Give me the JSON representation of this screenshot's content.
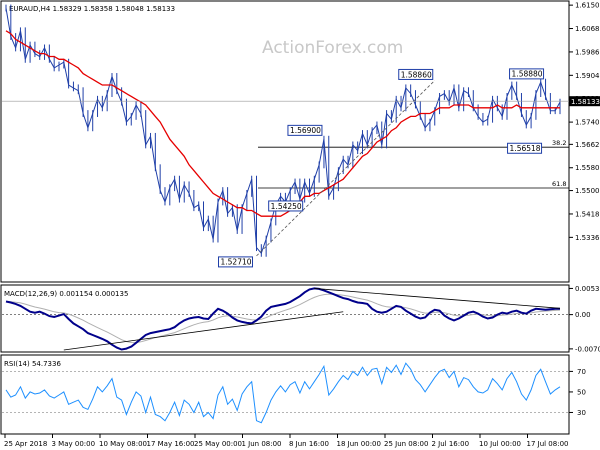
{
  "watermark": "ActionForex.com",
  "chart_data": [
    {
      "type": "line",
      "title": "EURAUD,H4  1.58329 1.58358 1.58048 1.58133",
      "series": [
        {
          "values": [
            1.614,
            1.604,
            1.6,
            1.606,
            1.596,
            1.601,
            1.598,
            1.597,
            1.6,
            1.596,
            1.593,
            1.594,
            1.595,
            1.587,
            1.586,
            1.585,
            1.577,
            1.572,
            1.577,
            1.582,
            1.579,
            1.584,
            1.59,
            1.585,
            1.581,
            1.574,
            1.576,
            1.58,
            1.577,
            1.566,
            1.569,
            1.558,
            1.55,
            1.546,
            1.551,
            1.554,
            1.547,
            1.552,
            1.549,
            1.544,
            1.545,
            1.537,
            1.54,
            1.533,
            1.546,
            1.55,
            1.542,
            1.544,
            1.536,
            1.544,
            1.549,
            1.554,
            1.53,
            1.528,
            1.533,
            1.539,
            1.545,
            1.548,
            1.546,
            1.55,
            1.553,
            1.547,
            1.553,
            1.549,
            1.554,
            1.559,
            1.568,
            1.548,
            1.551,
            1.557,
            1.561,
            1.559,
            1.566,
            1.564,
            1.57,
            1.566,
            1.571,
            1.573,
            1.566,
            1.577,
            1.575,
            1.582,
            1.579,
            1.586,
            1.584,
            1.58,
            1.576,
            1.572,
            1.574,
            1.578,
            1.583,
            1.584,
            1.581,
            1.586,
            1.579,
            1.585,
            1.584,
            1.579,
            1.576,
            1.574,
            1.575,
            1.582,
            1.579,
            1.576,
            1.583,
            1.587,
            1.583,
            1.577,
            1.573,
            1.576,
            1.584,
            1.588,
            1.583,
            1.578,
            1.578,
            1.581
          ]
        },
        {
          "values": [
            1.606,
            1.605,
            1.603,
            1.602,
            1.601,
            1.6,
            1.599,
            1.598,
            1.598,
            1.597,
            1.597,
            1.596,
            1.596,
            1.595,
            1.594,
            1.593,
            1.591,
            1.59,
            1.589,
            1.588,
            1.587,
            1.587,
            1.587,
            1.586,
            1.585,
            1.584,
            1.583,
            1.582,
            1.581,
            1.58,
            1.578,
            1.576,
            1.574,
            1.571,
            1.568,
            1.566,
            1.564,
            1.562,
            1.559,
            1.557,
            1.555,
            1.553,
            1.551,
            1.549,
            1.548,
            1.547,
            1.546,
            1.545,
            1.544,
            1.544,
            1.543,
            1.543,
            1.542,
            1.541,
            1.541,
            1.541,
            1.541,
            1.541,
            1.542,
            1.543,
            1.545,
            1.546,
            1.548,
            1.548,
            1.549,
            1.549,
            1.55,
            1.551,
            1.552,
            1.553,
            1.554,
            1.556,
            1.558,
            1.56,
            1.562,
            1.563,
            1.565,
            1.567,
            1.568,
            1.569,
            1.571,
            1.572,
            1.574,
            1.575,
            1.576,
            1.576,
            1.577,
            1.577,
            1.577,
            1.578,
            1.579,
            1.579,
            1.579,
            1.58,
            1.58,
            1.58,
            1.58,
            1.579,
            1.579,
            1.579,
            1.579,
            1.579,
            1.58,
            1.579,
            1.579,
            1.579,
            1.58,
            1.579,
            1.579,
            1.579,
            1.579,
            1.579,
            1.579,
            1.579,
            1.579,
            1.579
          ]
        }
      ],
      "ylim": [
        1.5183,
        1.6161
      ],
      "y_ticks": [
        "1.61500",
        "1.60680",
        "1.59860",
        "1.59040",
        "1.58220",
        "1.57400",
        "1.56620",
        "1.55800",
        "1.55000",
        "1.54180",
        "1.53360"
      ],
      "last_price": "1.58133",
      "callouts": [
        {
          "text": "1.58860",
          "price": 1.5886,
          "index": 89
        },
        {
          "text": "1.58880",
          "price": 1.5888,
          "index": 112
        },
        {
          "text": "1.56900",
          "price": 1.569,
          "index": 66
        },
        {
          "text": "1.56518",
          "price": 1.56518,
          "index": 112
        },
        {
          "text": "1.54250",
          "price": 1.5425,
          "index": 62
        },
        {
          "text": "1.52710",
          "price": 1.5271,
          "index": 52
        }
      ],
      "fib_levels": [
        {
          "label": "38.2",
          "price": 1.5652
        },
        {
          "label": "61.8",
          "price": 1.5509
        }
      ],
      "trendlines": [
        {
          "from_index": 52,
          "from_price": 1.5271,
          "to_index": 89,
          "to_price": 1.5886
        }
      ],
      "colors": {
        "price": "#1f3fa8",
        "ma": "#e60000",
        "axis": "#000000",
        "callout_border": "#1f3fa8",
        "last_bg": "#000000"
      }
    },
    {
      "type": "line",
      "title": "MACD(12,26,9) 0.001154 0.000135",
      "series": [
        {
          "values": [
            0.0027,
            0.0025,
            0.0022,
            0.0018,
            0.0012,
            0.0006,
            0.0004,
            0.0006,
            0.0002,
            -0.0003,
            -0.0005,
            -0.0002,
            0.0001,
            -0.0009,
            -0.0018,
            -0.0024,
            -0.003,
            -0.0038,
            -0.0042,
            -0.0046,
            -0.005,
            -0.0055,
            -0.0062,
            -0.0068,
            -0.0072,
            -0.007,
            -0.0066,
            -0.0058,
            -0.005,
            -0.0042,
            -0.0038,
            -0.0036,
            -0.0034,
            -0.0032,
            -0.003,
            -0.0026,
            -0.0018,
            -0.0012,
            -0.0008,
            -0.0006,
            -0.0005,
            -0.0008,
            -0.0009,
            0.0002,
            0.0012,
            0.0008,
            0.0002,
            -0.0006,
            -0.0012,
            -0.0015,
            -0.0017,
            -0.0018,
            -0.0012,
            -0.0004,
            0.0008,
            0.0016,
            0.0018,
            0.002,
            0.0022,
            0.0026,
            0.0032,
            0.0038,
            0.0046,
            0.0052,
            0.0054,
            0.0053,
            0.005,
            0.0046,
            0.0042,
            0.0038,
            0.0034,
            0.0032,
            0.0028,
            0.0025,
            0.0024,
            0.0022,
            0.0012,
            0.0006,
            0.0004,
            0.0006,
            0.0012,
            0.0018,
            0.0016,
            0.0008,
            0.0002,
            -0.0004,
            -0.0008,
            -0.0006,
            0.0004,
            0.001,
            0.0008,
            -0.0002,
            -0.0008,
            -0.0012,
            -0.0008,
            -0.0002,
            0.0004,
            0.0006,
            0.0002,
            -0.0004,
            -0.0008,
            -0.0006,
            0.0,
            0.0004,
            0.0002,
            0.0006,
            0.0008,
            0.0004,
            0.0002,
            0.0008,
            0.0012,
            0.0011,
            0.001,
            0.0011,
            0.0012,
            0.0012
          ]
        }
      ],
      "ylim": [
        -0.0075,
        0.0059
      ],
      "y_ticks": [
        "0.005398",
        "0.00",
        "-0.007064"
      ],
      "trendlines": [
        {
          "from_index": 12,
          "from_value": -0.0073,
          "to_index": 70,
          "to_value": 0.0006
        },
        {
          "from_index": 64,
          "from_value": 0.0054,
          "to_index": 115,
          "to_value": 0.0013
        }
      ],
      "colors": {
        "line": "#00008b",
        "signal": "#b0b0b0",
        "trend": "#000000"
      }
    },
    {
      "type": "line",
      "title": "RSI(14) 54.7336",
      "series": [
        {
          "values": [
            52,
            45,
            47,
            55,
            44,
            50,
            48,
            49,
            52,
            46,
            44,
            47,
            50,
            38,
            40,
            42,
            35,
            33,
            43,
            55,
            50,
            56,
            63,
            45,
            42,
            28,
            40,
            50,
            46,
            30,
            45,
            28,
            26,
            22,
            30,
            40,
            27,
            42,
            38,
            30,
            40,
            26,
            30,
            24,
            47,
            55,
            38,
            43,
            32,
            48,
            55,
            60,
            22,
            20,
            30,
            42,
            50,
            56,
            50,
            57,
            60,
            49,
            60,
            53,
            60,
            67,
            75,
            47,
            53,
            60,
            66,
            62,
            70,
            66,
            74,
            66,
            72,
            73,
            58,
            74,
            69,
            76,
            67,
            78,
            72,
            62,
            57,
            50,
            57,
            64,
            70,
            72,
            64,
            70,
            55,
            64,
            62,
            55,
            50,
            49,
            52,
            63,
            58,
            52,
            63,
            69,
            60,
            48,
            42,
            52,
            66,
            72,
            60,
            48,
            52,
            55
          ]
        }
      ],
      "ylim": [
        10,
        85
      ],
      "y_ticks": [
        "70",
        "50",
        "30"
      ],
      "colors": {
        "line": "#1e90ff"
      }
    }
  ],
  "x_axis_labels": [
    "25 Apr 2018",
    "3 May 00:00",
    "10 May 08:00",
    "17 May 16:00",
    "25 May 00:00",
    "1 Jun 08:00",
    "8 Jun 16:00",
    "18 Jun 00:00",
    "25 Jun 08:00",
    "2 Jul 16:00",
    "10 Jul 00:00",
    "17 Jul 08:00"
  ]
}
